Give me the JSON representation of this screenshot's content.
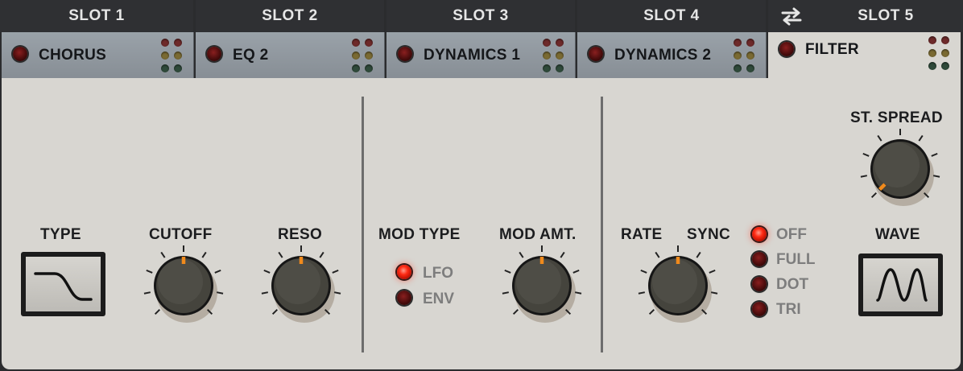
{
  "slots": [
    {
      "header": "SLOT 1",
      "effect": "CHORUS",
      "active": false
    },
    {
      "header": "SLOT 2",
      "effect": "EQ 2",
      "active": false
    },
    {
      "header": "SLOT 3",
      "effect": "DYNAMICS 1",
      "active": false
    },
    {
      "header": "SLOT 4",
      "effect": "DYNAMICS 2",
      "active": false
    },
    {
      "header": "SLOT 5",
      "effect": "FILTER",
      "active": true
    }
  ],
  "controls": {
    "type_label": "TYPE",
    "cutoff_label": "CUTOFF",
    "reso_label": "RESO",
    "mod_type_label": "MOD TYPE",
    "mod_type_options": [
      "LFO",
      "ENV"
    ],
    "mod_type_selected": "LFO",
    "mod_amt_label": "MOD AMT.",
    "rate_label": "RATE",
    "sync_label": "SYNC",
    "sync_options": [
      "OFF",
      "FULL",
      "DOT",
      "TRI"
    ],
    "sync_selected": "OFF",
    "st_spread_label": "ST. SPREAD",
    "wave_label": "WAVE"
  },
  "knob_values": {
    "cutoff": 0.5,
    "reso": 0.5,
    "mod_amt": 0.5,
    "rate": 0.5,
    "st_spread": 0.0
  },
  "colors": {
    "accent_orange": "#f08a1c",
    "led_on": "#ff2b14",
    "led_off": "#5a1010",
    "panel": "#d8d6d1",
    "tab_inactive": "#8f969d"
  }
}
